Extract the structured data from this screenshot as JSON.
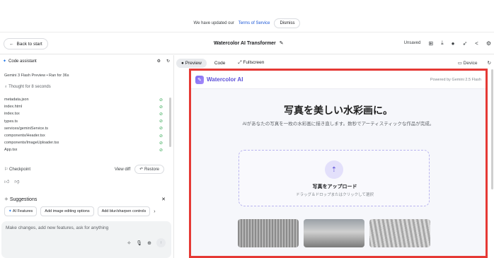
{
  "banner": {
    "text": "We have updated our",
    "link": "Terms of Service",
    "dismiss": "Dismiss"
  },
  "header": {
    "back": "Back to start",
    "title": "Watercolor AI Transformer",
    "unsaved": "Unsaved",
    "icons": [
      "save-icon",
      "download-icon",
      "github-icon",
      "rocket-icon",
      "share-icon",
      "settings-icon"
    ]
  },
  "left": {
    "assistant": "Code assistant",
    "model_line": "Gemini 3 Flash Preview  •  Ran for 36s",
    "thought": "Thought for 8 seconds",
    "files": [
      "metadata.json",
      "index.html",
      "index.tsx",
      "types.ts",
      "services/geminiService.ts",
      "components/Header.tsx",
      "components/ImageUploader.tsx",
      "App.tsx"
    ],
    "checkpoint": "Checkpoint",
    "view_diff": "View diff",
    "restore": "Restore",
    "suggestions_title": "Suggestions",
    "chips": [
      "AI Features",
      "Add image editing options",
      "Add blur/sharpen controls"
    ],
    "prompt_placeholder": "Make changes, add new features, ask for anything"
  },
  "right": {
    "tabs": [
      "Preview",
      "Code",
      "Fullscreen"
    ],
    "device": "Device",
    "app": {
      "brand": "Watercolor AI",
      "powered": "Powered by Gemini 2.5 Flash",
      "title": "写真を美しい水彩画に。",
      "subtitle": "AIがあなたの写真を一枚の水彩画に描き直します。数秒でアーティスティックな作品が完成。",
      "upload_title": "写真をアップロード",
      "upload_hint": "ドラッグ＆ドロップまたはクリックして選択"
    }
  },
  "colors": {
    "accent": "#5b4fd9",
    "highlight_border": "#e53935",
    "check": "#34a853",
    "link": "#1a56d6"
  }
}
